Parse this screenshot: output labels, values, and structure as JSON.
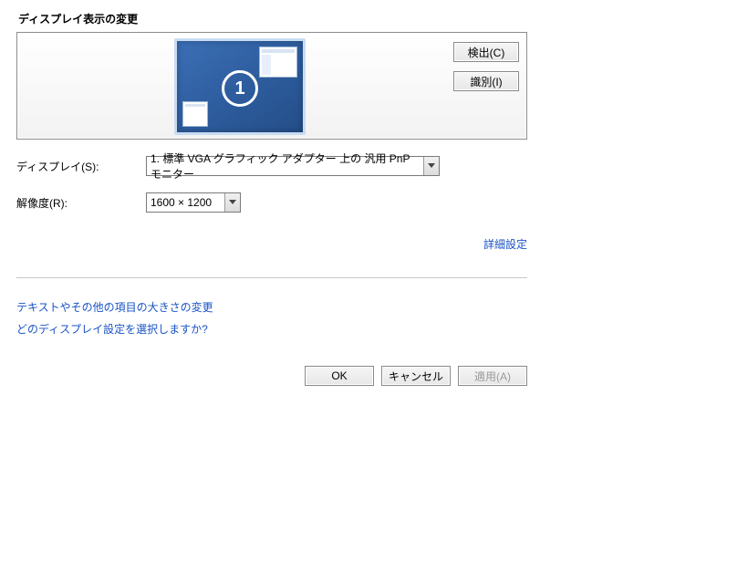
{
  "title": "ディスプレイ表示の変更",
  "preview": {
    "monitor_number": "1",
    "detect_label": "検出(C)",
    "identify_label": "識別(I)"
  },
  "fields": {
    "display_label": "ディスプレイ(S):",
    "display_value": "1. 標準 VGA グラフィック アダプター 上の 汎用 PnP モニター",
    "resolution_label": "解像度(R):",
    "resolution_value": "1600 × 1200"
  },
  "advanced_link": "詳細設定",
  "help_links": {
    "text_size": "テキストやその他の項目の大きさの変更",
    "which_setting": "どのディスプレイ設定を選択しますか?"
  },
  "buttons": {
    "ok": "OK",
    "cancel": "キャンセル",
    "apply": "適用(A)"
  }
}
